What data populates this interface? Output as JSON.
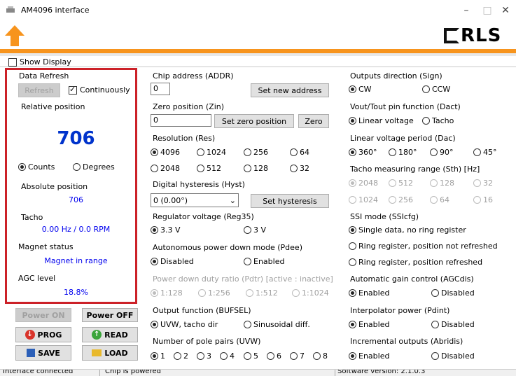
{
  "window": {
    "title": "AM4096 interface"
  },
  "header": {
    "logo_text": "RLS"
  },
  "show_display": {
    "label": "Show Display",
    "checked": false
  },
  "data_refresh": {
    "title": "Data Refresh",
    "refresh_label": "Refresh",
    "continuously_label": "Continuously",
    "continuously_checked": true
  },
  "relative_position": {
    "title": "Relative position",
    "value": "706",
    "counts_label": "Counts",
    "degrees_label": "Degrees",
    "selected": "Counts"
  },
  "absolute_position": {
    "title": "Absolute position",
    "value": "706"
  },
  "tacho": {
    "title": "Tacho",
    "value": "0.00 Hz / 0.0 RPM"
  },
  "magnet_status": {
    "title": "Magnet status",
    "value": "Magnet in range"
  },
  "agc_level": {
    "title": "AGC level",
    "value": "18.8%"
  },
  "power": {
    "on_label": "Power ON",
    "off_label": "Power OFF"
  },
  "actions": {
    "prog_label": "PROG",
    "read_label": "READ",
    "save_label": "SAVE",
    "load_label": "LOAD"
  },
  "chip_address": {
    "title": "Chip address  (ADDR)",
    "value": "0",
    "button": "Set new address"
  },
  "zero_position": {
    "title": "Zero position  (Zin)",
    "value": "0",
    "set_button": "Set zero position",
    "zero_button": "Zero"
  },
  "resolution": {
    "title": "Resolution (Res)",
    "options": [
      "4096",
      "1024",
      "256",
      "64",
      "2048",
      "512",
      "128",
      "32"
    ],
    "selected": "4096"
  },
  "digital_hysteresis": {
    "title": "Digital hysteresis (Hyst)",
    "value": "0 (0.00°)",
    "button": "Set hysteresis"
  },
  "regulator_voltage": {
    "title": "Regulator voltage (Reg35)",
    "options": [
      "3.3 V",
      "3 V"
    ],
    "selected": "3.3 V"
  },
  "autonomous_power_down": {
    "title": "Autonomous power down mode (Pdee)",
    "options": [
      "Disabled",
      "Enabled"
    ],
    "selected": "Disabled"
  },
  "power_down_duty": {
    "title": "Power down duty ratio (Pdtr) [active : inactive]",
    "options": [
      "1:128",
      "1:256",
      "1:512",
      "1:1024"
    ],
    "selected": "1:128"
  },
  "output_function": {
    "title": "Output function (BUFSEL)",
    "options": [
      "UVW, tacho dir",
      "Sinusoidal diff."
    ],
    "selected": "UVW, tacho dir"
  },
  "pole_pairs": {
    "title": "Number of pole pairs (UVW)",
    "options": [
      "1",
      "2",
      "3",
      "4",
      "5",
      "6",
      "7",
      "8"
    ],
    "selected": "1"
  },
  "outputs_direction": {
    "title": "Outputs direction (Sign)",
    "options": [
      "CW",
      "CCW"
    ],
    "selected": "CW"
  },
  "vout_function": {
    "title": "Vout/Tout pin function (Dact)",
    "options": [
      "Linear voltage",
      "Tacho"
    ],
    "selected": "Linear voltage"
  },
  "linear_voltage_period": {
    "title": "Linear voltage period (Dac)",
    "options": [
      "360°",
      "180°",
      "90°",
      "45°"
    ],
    "selected": "360°"
  },
  "tacho_range": {
    "title": "Tacho measuring range (Sth) [Hz]",
    "options": [
      "2048",
      "512",
      "128",
      "32",
      "1024",
      "256",
      "64",
      "16"
    ],
    "selected": "2048"
  },
  "ssi_mode": {
    "title": "SSI mode (SSIcfg)",
    "options": [
      "Single data, no ring register",
      "Ring register, position not refreshed",
      "Ring register, position refreshed"
    ],
    "selected": "Single data, no ring register"
  },
  "agc": {
    "title": "Automatic gain control (AGCdis)",
    "options": [
      "Enabled",
      "Disabled"
    ],
    "selected": "Enabled"
  },
  "interpolator_power": {
    "title": "Interpolator power (Pdint)",
    "options": [
      "Enabled",
      "Disabled"
    ],
    "selected": "Enabled"
  },
  "incremental_outputs": {
    "title": "Incremental outputs (Abridis)",
    "options": [
      "Enabled",
      "Disabled"
    ],
    "selected": "Enabled"
  },
  "status": {
    "interface": "Interface connected",
    "chip": "Chip is powered",
    "software": "Software version: 2.1.0.3"
  },
  "colors": {
    "accent_orange": "#f7941d",
    "highlight_red": "#cc2128",
    "value_blue": "#0000ee"
  }
}
